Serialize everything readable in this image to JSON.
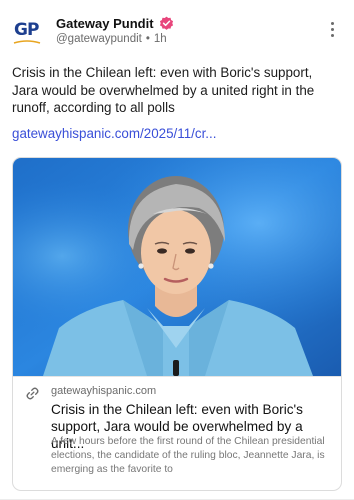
{
  "author": {
    "avatar_text": "GP",
    "name": "Gateway Pundit",
    "handle": "@gatewaypundit",
    "separator": "•",
    "time": "1h"
  },
  "post": {
    "text": "Crisis in the Chilean left: even with Boric's support, Jara would be overwhelmed by a united right in the runoff, according to all polls",
    "link_text": "gatewayhispanic.com/2025/11/cr..."
  },
  "card": {
    "domain": "gatewayhispanic.com",
    "title": "Crisis in the Chilean left: even with Boric's support, Jara would be overwhelmed by a unit...",
    "description": "A few hours before the first round of the Chilean presidential elections, the candidate of the ruling bloc, Jeannette Jara, is emerging as the favorite to"
  },
  "icons": {
    "verified": "verified-badge-icon",
    "more": "more-options-icon",
    "link": "link-icon"
  },
  "colors": {
    "link": "#3a4fd8",
    "verified_badge": "#e8467c",
    "avatar_brand": "#1d3f8f"
  }
}
